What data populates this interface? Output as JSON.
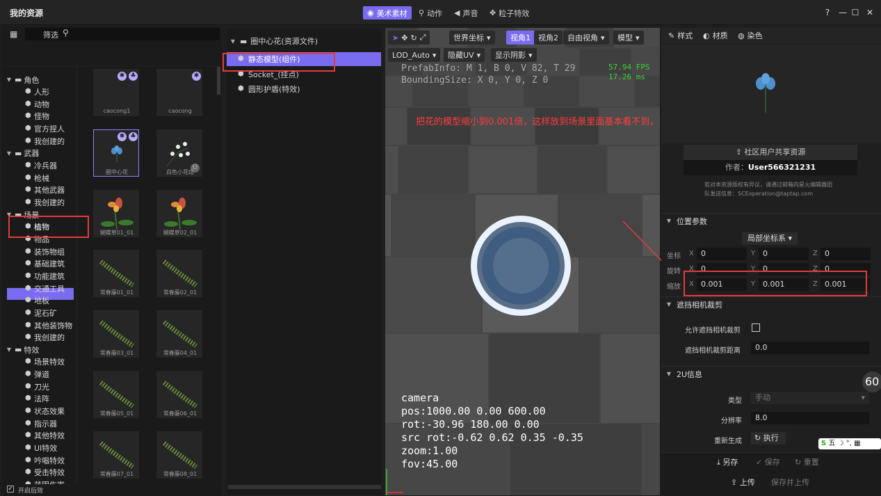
{
  "title": "我的资源",
  "top_tabs": [
    {
      "label": "美术素材",
      "icon": "palette-icon",
      "active": true
    },
    {
      "label": "动作",
      "icon": "run-icon",
      "active": false
    },
    {
      "label": "声音",
      "icon": "speaker-icon",
      "active": false
    },
    {
      "label": "粒子特效",
      "icon": "sparkle-icon",
      "active": false
    }
  ],
  "window_controls": {
    "help": "?",
    "minimize": "—",
    "maximize": "☐",
    "close": "✕"
  },
  "filter": {
    "label": "筛选",
    "value": ""
  },
  "tree": [
    {
      "label": "角色",
      "level": 0
    },
    {
      "label": "人形",
      "level": 1
    },
    {
      "label": "动物",
      "level": 1
    },
    {
      "label": "怪物",
      "level": 1
    },
    {
      "label": "官方捏人",
      "level": 1
    },
    {
      "label": "我创建的",
      "level": 1
    },
    {
      "label": "武器",
      "level": 0
    },
    {
      "label": "冷兵器",
      "level": 1
    },
    {
      "label": "枪械",
      "level": 1
    },
    {
      "label": "其他武器",
      "level": 1
    },
    {
      "label": "我创建的",
      "level": 1
    },
    {
      "label": "场景",
      "level": 0
    },
    {
      "label": "植物",
      "level": 1
    },
    {
      "label": "物品",
      "level": 1
    },
    {
      "label": "装饰物组",
      "level": 1
    },
    {
      "label": "基础建筑",
      "level": 1
    },
    {
      "label": "功能建筑",
      "level": 1
    },
    {
      "label": "交通工具",
      "level": 1
    },
    {
      "label": "地板",
      "level": 1
    },
    {
      "label": "泥石矿",
      "level": 1
    },
    {
      "label": "其他装饰物",
      "level": 1
    },
    {
      "label": "我创建的",
      "level": 1
    },
    {
      "label": "特效",
      "level": 0
    },
    {
      "label": "场景特效",
      "level": 1
    },
    {
      "label": "弹道",
      "level": 1
    },
    {
      "label": "刀光",
      "level": 1
    },
    {
      "label": "法阵",
      "level": 1
    },
    {
      "label": "状态效果",
      "level": 1
    },
    {
      "label": "指示器",
      "level": 1
    },
    {
      "label": "其他特效",
      "level": 1
    },
    {
      "label": "UI特效",
      "level": 1
    },
    {
      "label": "吟唱特效",
      "level": 1
    },
    {
      "label": "受击特效",
      "level": 1
    },
    {
      "label": "范围伤害",
      "level": 1
    }
  ],
  "thumbs": [
    {
      "label": "caocong1",
      "art": "none"
    },
    {
      "label": "caocong",
      "art": "none"
    },
    {
      "label": "圈中心花",
      "art": "blueflower"
    },
    {
      "label": "白色小花组",
      "art": "whiteflowers"
    },
    {
      "label": "蝴蝶草01_01",
      "art": "orchid"
    },
    {
      "label": "蝴蝶草02_01",
      "art": "orchid"
    },
    {
      "label": "常春藤01_01",
      "art": "ivy"
    },
    {
      "label": "常春藤02_01",
      "art": "ivy"
    },
    {
      "label": "常春藤03_01",
      "art": "ivy"
    },
    {
      "label": "常春藤04_01",
      "art": "ivy"
    },
    {
      "label": "常春藤05_01",
      "art": "ivy"
    },
    {
      "label": "常春藤06_01",
      "art": "ivy"
    },
    {
      "label": "常春藤07_01",
      "art": "ivy"
    },
    {
      "label": "常春藤08_01",
      "art": "ivy"
    }
  ],
  "footer": {
    "checkbox_label": "开启后效",
    "checked": true
  },
  "mid_tree": {
    "root": "圈中心花(资源文件)",
    "items": [
      {
        "label": "静态模型(组件)",
        "selected": true
      },
      {
        "label": "Socket_(挂点)",
        "selected": false
      },
      {
        "label": "圆形护盾(特效)",
        "selected": false
      }
    ]
  },
  "viewport": {
    "toolbar_row1": [
      {
        "label": "世界坐标",
        "active": false
      },
      {
        "label": "视角1",
        "active": true
      },
      {
        "label": "视角2",
        "active": false
      },
      {
        "label": "自由视角",
        "active": false
      },
      {
        "label": "模型",
        "active": false
      }
    ],
    "toolbar_row2": [
      {
        "label": "LOD_Auto"
      },
      {
        "label": "隐藏UV"
      },
      {
        "label": "显示阴影"
      }
    ],
    "prefab_info": "PrefabInfo: M 1, B 0, V 82, T 29",
    "bounding_size": "BoundingSize: X 0, Y 0, Z 0",
    "fps": "57.94 FPS",
    "ms": "17.26 ms",
    "annotation": "把花的模型缩小到0.001倍，这样放到场景里面基本看不到，或者看到一点点",
    "camera": [
      "camera",
      "pos:1000.00 0.00 600.00",
      "rot:-30.96 180.00 0.00",
      "src rot:-0.62 0.62 0.35 -0.35",
      "zoom:1.00",
      "fov:45.00"
    ]
  },
  "right": {
    "tabs": [
      {
        "label": "样式",
        "icon": "edit-icon"
      },
      {
        "label": "材质",
        "icon": "material-icon"
      },
      {
        "label": "染色",
        "icon": "dye-icon"
      }
    ],
    "share_button": "社区用户共享资源",
    "author_label": "作者：",
    "author": "User566321231",
    "copyright_line1": "若对本资源版权有异议，请通过邮箱向星火编辑器团",
    "copyright_line2": "队发送信息：SCEoperation@taptap.com",
    "position_section": "位置参数",
    "coord_mode": "局部坐标系",
    "rows": [
      {
        "label": "坐标",
        "x": "0",
        "y": "0",
        "z": "0"
      },
      {
        "label": "旋转",
        "x": "0",
        "y": "0",
        "z": "0"
      },
      {
        "label": "缩放",
        "x": "0.001",
        "y": "0.001",
        "z": "0.001"
      }
    ],
    "occlusion_section": "遮挡相机裁剪",
    "allow_occlusion_label": "允许遮挡相机裁剪",
    "occlusion_distance_label": "遮挡相机裁剪距离",
    "occlusion_distance": "0.0",
    "uv_section": "2U信息",
    "type_label": "类型",
    "type_value": "手动",
    "resolution_label": "分辨率",
    "resolution_value": "8.0",
    "regen_label": "重新生成",
    "run_button": "执行",
    "save_as": "另存",
    "save": "保存",
    "reset": "重置",
    "upload": "上传",
    "save_upload": "保存并上传",
    "side_badge": "60",
    "ime": "五"
  }
}
